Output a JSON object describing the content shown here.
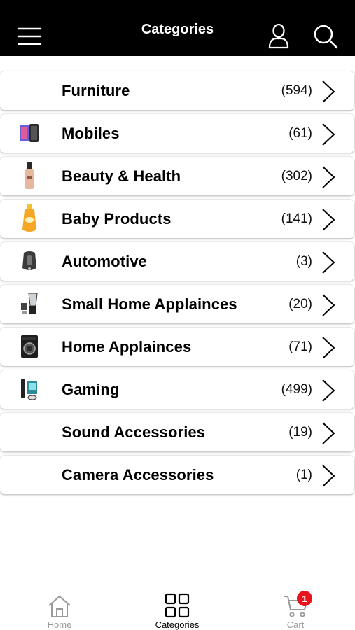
{
  "header": {
    "title": "Categories",
    "menu_icon": "hamburger-menu-icon",
    "user_icon": "user-icon",
    "search_icon": "search-icon"
  },
  "categories": [
    {
      "name": "Furniture",
      "count": "(594)",
      "thumb": "none"
    },
    {
      "name": "Mobiles",
      "count": "(61)",
      "thumb": "phone"
    },
    {
      "name": "Beauty & Health",
      "count": "(302)",
      "thumb": "foundation-bottle"
    },
    {
      "name": "Baby Products",
      "count": "(141)",
      "thumb": "baby-shampoo"
    },
    {
      "name": "Automotive",
      "count": "(3)",
      "thumb": "car-seat"
    },
    {
      "name": "Small Home Applainces",
      "count": "(20)",
      "thumb": "blender"
    },
    {
      "name": "Home Applainces",
      "count": "(71)",
      "thumb": "washing-machine"
    },
    {
      "name": "Gaming",
      "count": "(499)",
      "thumb": "console"
    },
    {
      "name": "Sound Accessories",
      "count": "(19)",
      "thumb": "none"
    },
    {
      "name": "Camera Accessories",
      "count": "(1)",
      "thumb": "none"
    }
  ],
  "tabbar": {
    "home_label": "Home",
    "categories_label": "Categories",
    "cart_label": "Cart",
    "cart_badge": "1"
  },
  "colors": {
    "header_bg": "#000000",
    "badge": "#e8131d",
    "inactive_tab": "#9a9a9a"
  }
}
